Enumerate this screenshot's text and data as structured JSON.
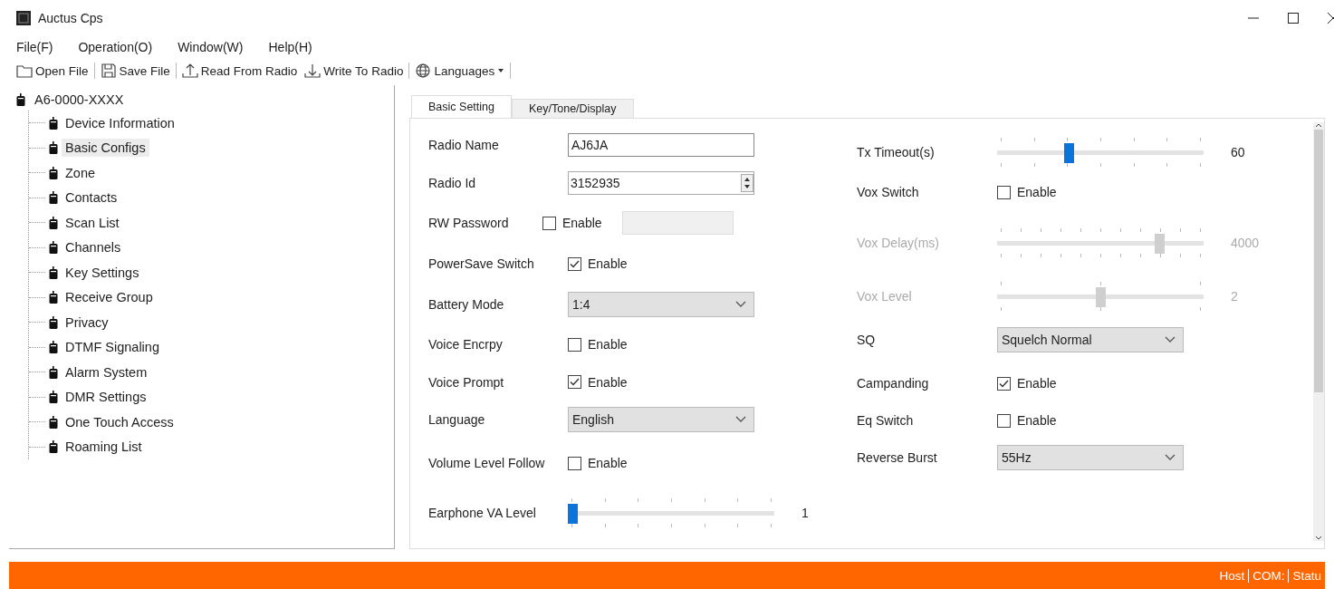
{
  "window": {
    "title": "Auctus Cps"
  },
  "menu": [
    "File(F)",
    "Operation(O)",
    "Window(W)",
    "Help(H)"
  ],
  "toolbar": [
    {
      "kind": "open",
      "label": "Open File"
    },
    {
      "kind": "save",
      "label": "Save File"
    },
    {
      "kind": "read",
      "label": "Read From Radio"
    },
    {
      "kind": "write",
      "label": "Write To Radio"
    },
    {
      "kind": "languages",
      "label": "Languages"
    }
  ],
  "tree": {
    "label": "A6-0000-XXXX",
    "selected": false,
    "children": [
      {
        "label": "Device Information",
        "selected": false
      },
      {
        "label": "Basic Configs",
        "selected": true
      },
      {
        "label": "Zone",
        "selected": false
      },
      {
        "label": "Contacts",
        "selected": false
      },
      {
        "label": "Scan List",
        "selected": false
      },
      {
        "label": "Channels",
        "selected": false
      },
      {
        "label": "Key Settings",
        "selected": false
      },
      {
        "label": "Receive Group",
        "selected": false
      },
      {
        "label": "Privacy",
        "selected": false
      },
      {
        "label": "DTMF Signaling",
        "selected": false
      },
      {
        "label": "Alarm System",
        "selected": false
      },
      {
        "label": "DMR Settings",
        "selected": false
      },
      {
        "label": "One Touch Access",
        "selected": false
      },
      {
        "label": "Roaming List",
        "selected": false
      }
    ]
  },
  "tabs": [
    {
      "label": "Basic Setting",
      "selected": true
    },
    {
      "label": "Key/Tone/Display",
      "selected": false
    }
  ],
  "left_fields": [
    {
      "kind": "text",
      "label": "Radio Name",
      "value": "AJ6JA"
    },
    {
      "kind": "spin",
      "label": "Radio Id",
      "value": "3152935"
    },
    {
      "kind": "checkbox_input",
      "label": "RW Password",
      "option": "Enable",
      "checked": false
    },
    {
      "kind": "checkbox",
      "label": "PowerSave Switch",
      "option": "Enable",
      "checked": true
    },
    {
      "kind": "select",
      "label": "Battery Mode",
      "value": "1:4"
    },
    {
      "kind": "checkbox",
      "label": "Voice Encrpy",
      "option": "Enable",
      "checked": false
    },
    {
      "kind": "checkbox",
      "label": "Voice Prompt",
      "option": "Enable",
      "checked": true
    },
    {
      "kind": "select",
      "label": "Language",
      "value": "English"
    },
    {
      "kind": "checkbox",
      "label": "Volume Level Follow",
      "option": "Enable",
      "checked": false
    },
    {
      "kind": "slider",
      "label": "Earphone VA Level",
      "level": 0,
      "reading": "1",
      "disabled": false
    }
  ],
  "right_fields": [
    {
      "kind": "slider",
      "label": "Tx Timeout(s)",
      "level": 0.34,
      "reading": "60",
      "disabled": false
    },
    {
      "kind": "checkbox",
      "label": "Vox Switch",
      "option": "Enable",
      "checked": false
    },
    {
      "kind": "slider",
      "label": "Vox Delay(ms)",
      "level": 0.8,
      "reading": "4000",
      "disabled": true
    },
    {
      "kind": "slider",
      "label": "Vox Level",
      "level": 0.5,
      "reading": "2",
      "disabled": true
    },
    {
      "kind": "select",
      "label": "SQ",
      "value": "Squelch Normal"
    },
    {
      "kind": "checkbox",
      "label": "Campanding",
      "option": "Enable",
      "checked": true
    },
    {
      "kind": "checkbox",
      "label": "Eq Switch",
      "option": "Enable",
      "checked": false
    },
    {
      "kind": "select",
      "label": "Reverse Burst",
      "value": "55Hz"
    }
  ],
  "status_bar": [
    "Host",
    "COM:",
    "Statu"
  ]
}
